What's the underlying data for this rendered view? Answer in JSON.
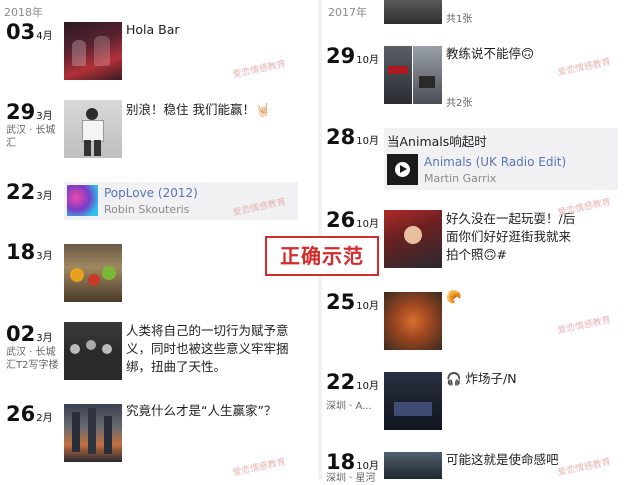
{
  "left": {
    "year": "2018年",
    "entries": [
      {
        "day": "03",
        "month": "4月",
        "text": "Hola Bar"
      },
      {
        "day": "29",
        "month": "3月",
        "location": "武汉 · 长城汇",
        "text": "别浪！稳住 我们能赢！🤘🏻"
      },
      {
        "day": "22",
        "month": "3月",
        "share_title": "PopLove (2012)",
        "share_sub": "Robin Skouteris"
      },
      {
        "day": "18",
        "month": "3月"
      },
      {
        "day": "02",
        "month": "3月",
        "location": "武汉 · 长城汇T2写字楼",
        "text": "人类将自己的一切行为赋予意义，同时也被这些意义牢牢捆绑，扭曲了天性。"
      },
      {
        "day": "26",
        "month": "2月",
        "text": "究竟什么才是“人生赢家”？"
      }
    ]
  },
  "right": {
    "year": "2017年",
    "entries": [
      {
        "day": "29",
        "month": "10月",
        "text": "教练说不能停🙃",
        "photo_count": "共2张"
      },
      {
        "day": "28",
        "month": "10月",
        "text": "当Animals响起时",
        "share_title": "Animals (UK Radio Edit)",
        "share_sub": "Martin Garrix"
      },
      {
        "day": "26",
        "month": "10月",
        "text": "好久没在一起玩耍！/后面你们好好逛街我就来拍个照🙃#"
      },
      {
        "day": "25",
        "month": "10月",
        "text": "🥐"
      },
      {
        "day": "22",
        "month": "10月",
        "location": "深圳 · A...",
        "text": "🎧 炸场子/N"
      },
      {
        "day": "18",
        "month": "10月",
        "location": "深圳 · 星河",
        "text": "可能这就是使命感吧"
      }
    ],
    "top_partial_text": "共1张"
  },
  "badge": "正确示范",
  "watermark": "爱恋情感教育",
  "colors": {
    "badge_red": "#d42b2b",
    "link_blue": "#5a74b5",
    "share_bg": "#f1f1f3"
  }
}
